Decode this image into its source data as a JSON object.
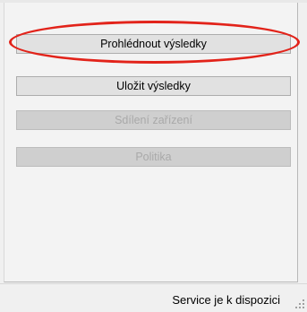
{
  "actions": {
    "view_results": "Prohlédnout výsledky",
    "save_results": "Uložit výsledky",
    "device_sharing": "Sdílení zařízení",
    "policy": "Politika"
  },
  "states": {
    "device_sharing_enabled": false,
    "policy_enabled": false
  },
  "annotation": {
    "highlight_color": "#e2231a"
  },
  "status": {
    "text": "Service je k dispozici"
  }
}
